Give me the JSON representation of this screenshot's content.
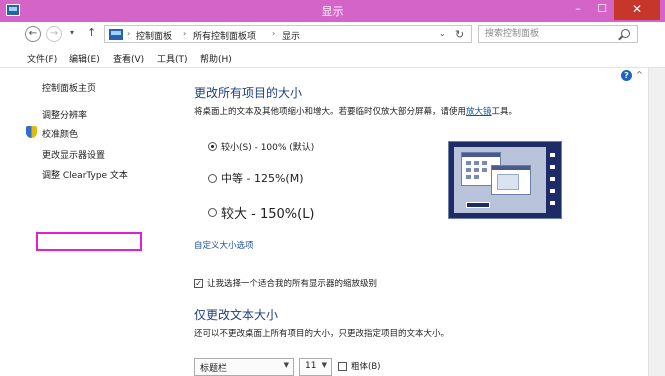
{
  "window": {
    "title": "显示",
    "minimize": "–",
    "maximize": "☐",
    "close": "✕"
  },
  "nav": {
    "back": "←",
    "forward": "→",
    "recent": "▾",
    "up": "↑"
  },
  "address": {
    "crumbs": [
      "控制面板",
      "所有控制面板项",
      "显示"
    ],
    "separator": "›",
    "dropdown": "⌄",
    "refresh": "↻"
  },
  "search": {
    "placeholder": "搜索控制面板"
  },
  "menubar": {
    "items": [
      "文件(F)",
      "编辑(E)",
      "查看(V)",
      "工具(T)",
      "帮助(H)"
    ]
  },
  "sidebar": {
    "items": [
      {
        "label": "控制面板主页"
      },
      {
        "label": "调整分辨率"
      },
      {
        "label": "校准颜色"
      },
      {
        "label": "更改显示器设置"
      },
      {
        "label": "调整 ClearType 文本"
      }
    ]
  },
  "main": {
    "heading": "更改所有项目的大小",
    "description_prefix": "将桌面上的文本及其他项缩小和增大。若要临时仅放大部分屏幕，请使用",
    "magnifier_link": "放大镜",
    "description_suffix": "工具。",
    "options": [
      {
        "label": "较小(S) - 100% (默认)",
        "selected": true
      },
      {
        "label": "中等 - 125%(M)",
        "selected": false
      },
      {
        "label": "较大 - 150%(L)",
        "selected": false
      }
    ],
    "custom_link": "自定义大小选项",
    "checkbox_label": "让我选择一个适合我的所有显示器的缩放级别",
    "checkbox_checked": true,
    "heading2": "仅更改文本大小",
    "description2": "还可以不更改桌面上所有项目的大小，只更改指定项目的文本大小。",
    "item_select": "标题栏",
    "size_select": "11",
    "bold_label": "粗体(B)",
    "bold_checked": false
  },
  "help": "?",
  "scroll_up": "^",
  "colors": {
    "titlebar": "#d564c9",
    "close": "#c7362a",
    "heading": "#1e3f80",
    "link": "#1a4f9c",
    "highlight_box": "#e020d6"
  },
  "icons": {
    "app": "display-icon",
    "search": "search-icon",
    "shield": "shield-icon",
    "help": "help-icon"
  }
}
